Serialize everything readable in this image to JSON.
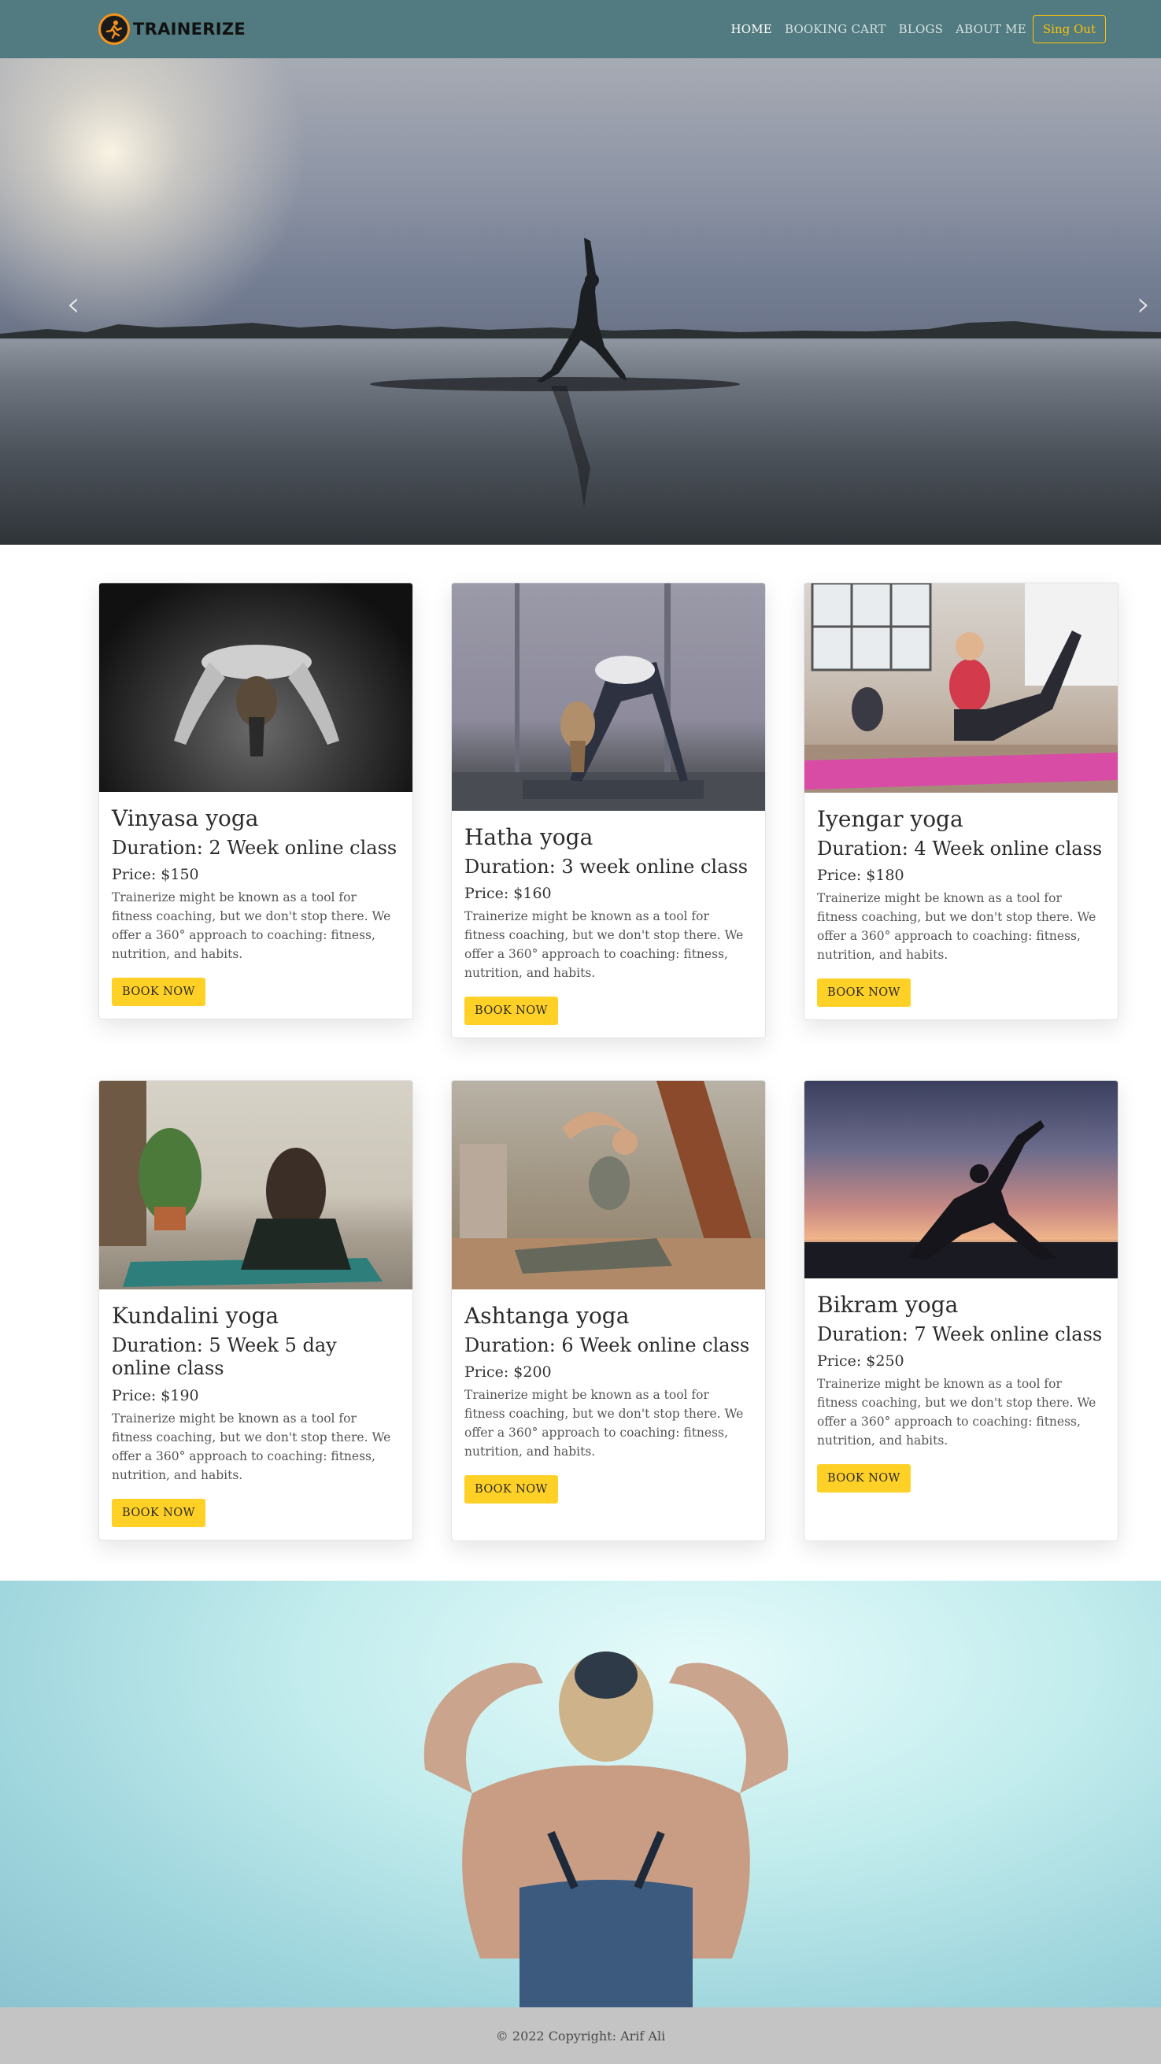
{
  "brand": {
    "name": "TRAINERIZE",
    "logo_icon": "runner-logo-icon"
  },
  "nav": {
    "links": [
      {
        "label": "HOME",
        "active": true
      },
      {
        "label": "BOOKING CART",
        "active": false
      },
      {
        "label": "BLOGS",
        "active": false
      },
      {
        "label": "ABOUT ME",
        "active": false
      }
    ],
    "signout_label": "Sing Out"
  },
  "hero": {
    "prev_icon": "chevron-left-icon",
    "next_icon": "chevron-right-icon",
    "prev_glyph": "‹",
    "next_glyph": "›"
  },
  "cards": [
    {
      "title": "Vinyasa yoga",
      "duration": "Duration: 2 Week online class",
      "price": "Price: $150",
      "desc": "Trainerize might be known as a tool for fitness coaching, but we don't stop there. We offer a 360° approach to coaching: fitness, nutrition, and habits.",
      "button": "BOOK NOW"
    },
    {
      "title": "Hatha yoga",
      "duration": "Duration: 3 week online class",
      "price": "Price: $160",
      "desc": "Trainerize might be known as a tool for fitness coaching, but we don't stop there. We offer a 360° approach to coaching: fitness, nutrition, and habits.",
      "button": "BOOK NOW"
    },
    {
      "title": "Iyengar yoga",
      "duration": "Duration: 4 Week online class",
      "price": "Price: $180",
      "desc": "Trainerize might be known as a tool for fitness coaching, but we don't stop there. We offer a 360° approach to coaching: fitness, nutrition, and habits.",
      "button": "BOOK NOW"
    },
    {
      "title": "Kundalini yoga",
      "duration": "Duration: 5 Week 5 day online class",
      "price": "Price: $190",
      "desc": "Trainerize might be known as a tool for fitness coaching, but we don't stop there. We offer a 360° approach to coaching: fitness, nutrition, and habits.",
      "button": "BOOK NOW"
    },
    {
      "title": "Ashtanga yoga",
      "duration": "Duration: 6 Week online class",
      "price": "Price: $200",
      "desc": "Trainerize might be known as a tool for fitness coaching, but we don't stop there. We offer a 360° approach to coaching: fitness, nutrition, and habits.",
      "button": "BOOK NOW"
    },
    {
      "title": "Bikram yoga",
      "duration": "Duration: 7 Week online class",
      "price": "Price: $250",
      "desc": "Trainerize might be known as a tool for fitness coaching, but we don't stop there. We offer a 360° approach to coaching: fitness, nutrition, and habits.",
      "button": "BOOK NOW"
    }
  ],
  "footer": {
    "copyright": "© 2022 Copyright: Arif Ali"
  }
}
